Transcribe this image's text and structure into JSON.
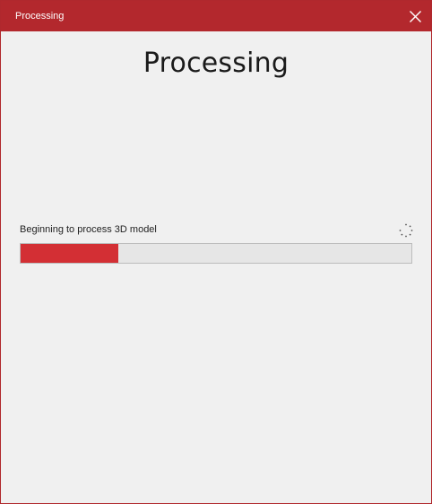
{
  "window": {
    "title": "Processing"
  },
  "main": {
    "heading": "Processing",
    "status_text": "Beginning to process 3D model",
    "progress": 0.25
  },
  "colors": {
    "accent": "#b3282d",
    "progress_fill": "#d32f34",
    "background": "#f0f0f0"
  },
  "icons": {
    "close": "close-icon",
    "spinner": "loading-spinner-icon"
  }
}
